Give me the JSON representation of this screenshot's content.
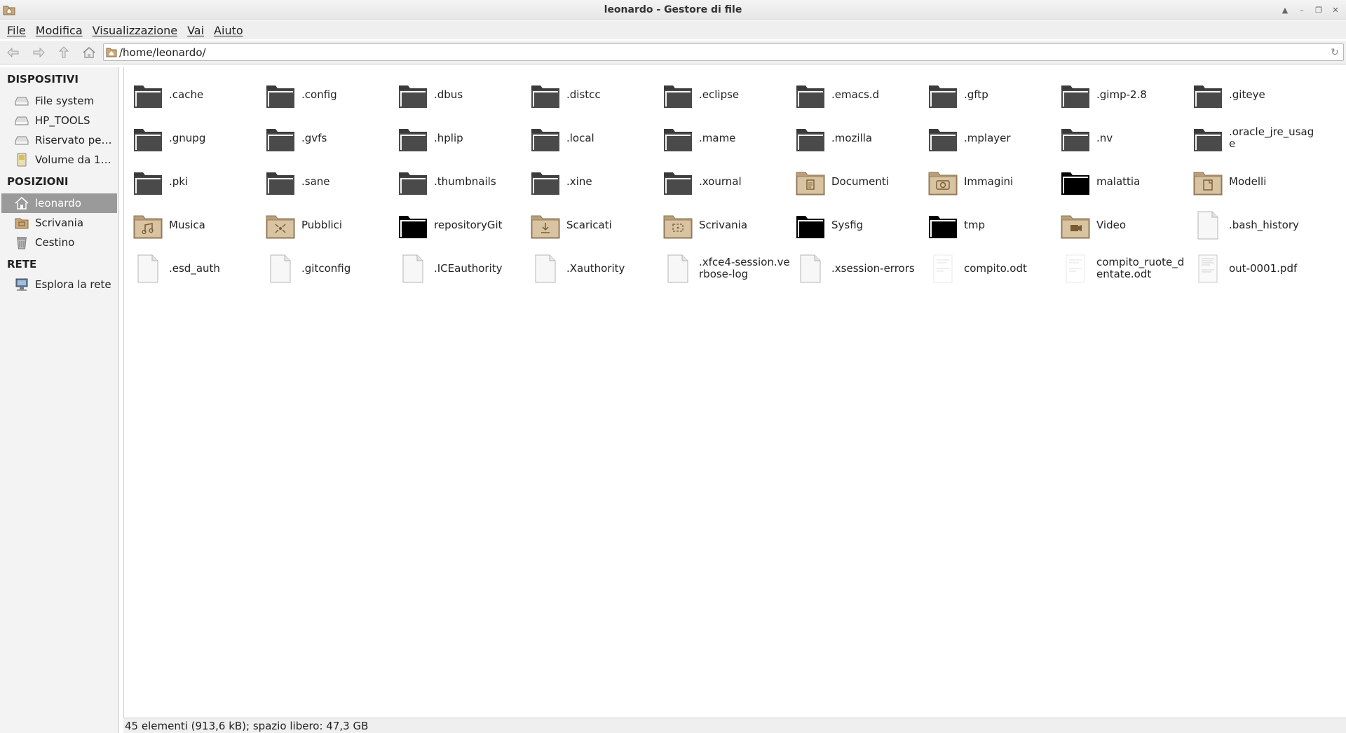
{
  "window": {
    "title": "leonardo - Gestore di file"
  },
  "menu": [
    "File",
    "Modifica",
    "Visualizzazione",
    "Vai",
    "Aiuto"
  ],
  "path": "/home/leonardo/",
  "sidebar": {
    "sections": [
      {
        "heading": "DISPOSITIVI",
        "items": [
          {
            "label": "File system",
            "icon": "drive-icon"
          },
          {
            "label": "HP_TOOLS",
            "icon": "drive-icon"
          },
          {
            "label": "Riservato per ...",
            "icon": "drive-icon"
          },
          {
            "label": "Volume da 16...",
            "icon": "removable-drive-icon"
          }
        ]
      },
      {
        "heading": "POSIZIONI",
        "items": [
          {
            "label": "leonardo",
            "icon": "home-icon",
            "selected": true
          },
          {
            "label": "Scrivania",
            "icon": "desktop-icon"
          },
          {
            "label": "Cestino",
            "icon": "trash-icon"
          }
        ]
      },
      {
        "heading": "RETE",
        "items": [
          {
            "label": "Esplora la rete",
            "icon": "network-icon"
          }
        ]
      }
    ]
  },
  "files": [
    {
      "name": ".cache",
      "type": "folder-dark"
    },
    {
      "name": ".config",
      "type": "folder-dark"
    },
    {
      "name": ".dbus",
      "type": "folder-dark"
    },
    {
      "name": ".distcc",
      "type": "folder-dark"
    },
    {
      "name": ".eclipse",
      "type": "folder-dark"
    },
    {
      "name": ".emacs.d",
      "type": "folder-dark"
    },
    {
      "name": ".gftp",
      "type": "folder-dark"
    },
    {
      "name": ".gimp-2.8",
      "type": "folder-dark"
    },
    {
      "name": ".giteye",
      "type": "folder-dark"
    },
    {
      "name": ".gnupg",
      "type": "folder-dark"
    },
    {
      "name": ".gvfs",
      "type": "folder-dark"
    },
    {
      "name": ".hplip",
      "type": "folder-dark"
    },
    {
      "name": ".local",
      "type": "folder-dark"
    },
    {
      "name": ".mame",
      "type": "folder-dark"
    },
    {
      "name": ".mozilla",
      "type": "folder-dark"
    },
    {
      "name": ".mplayer",
      "type": "folder-dark"
    },
    {
      "name": ".nv",
      "type": "folder-dark"
    },
    {
      "name": ".oracle_jre_usage",
      "type": "folder-dark"
    },
    {
      "name": ".pki",
      "type": "folder-dark"
    },
    {
      "name": ".sane",
      "type": "folder-dark"
    },
    {
      "name": ".thumbnails",
      "type": "folder-dark"
    },
    {
      "name": ".xine",
      "type": "folder-dark"
    },
    {
      "name": ".xournal",
      "type": "folder-dark"
    },
    {
      "name": "Documenti",
      "type": "folder-tan",
      "emblem": "documents"
    },
    {
      "name": "Immagini",
      "type": "folder-tan",
      "emblem": "camera"
    },
    {
      "name": "malattia",
      "type": "folder-black"
    },
    {
      "name": "Modelli",
      "type": "folder-tan",
      "emblem": "templates"
    },
    {
      "name": "Musica",
      "type": "folder-tan",
      "emblem": "music"
    },
    {
      "name": "Pubblici",
      "type": "folder-tan",
      "emblem": "share"
    },
    {
      "name": "repositoryGit",
      "type": "folder-black"
    },
    {
      "name": "Scaricati",
      "type": "folder-tan",
      "emblem": "download"
    },
    {
      "name": "Scrivania",
      "type": "folder-tan",
      "emblem": "desktop"
    },
    {
      "name": "Sysfig",
      "type": "folder-black"
    },
    {
      "name": "tmp",
      "type": "folder-black"
    },
    {
      "name": "Video",
      "type": "folder-tan",
      "emblem": "video"
    },
    {
      "name": ".bash_history",
      "type": "file"
    },
    {
      "name": ".esd_auth",
      "type": "file"
    },
    {
      "name": ".gitconfig",
      "type": "file"
    },
    {
      "name": ".ICEauthority",
      "type": "file"
    },
    {
      "name": ".Xauthority",
      "type": "file"
    },
    {
      "name": ".xfce4-session.verbose-log",
      "type": "file"
    },
    {
      "name": ".xsession-errors",
      "type": "file"
    },
    {
      "name": "compito.odt",
      "type": "doc"
    },
    {
      "name": "compito_ruote_dentate.odt",
      "type": "doc"
    },
    {
      "name": "out-0001.pdf",
      "type": "pdf"
    }
  ],
  "status": "45 elementi (913,6 kB); spazio libero: 47,3 GB"
}
